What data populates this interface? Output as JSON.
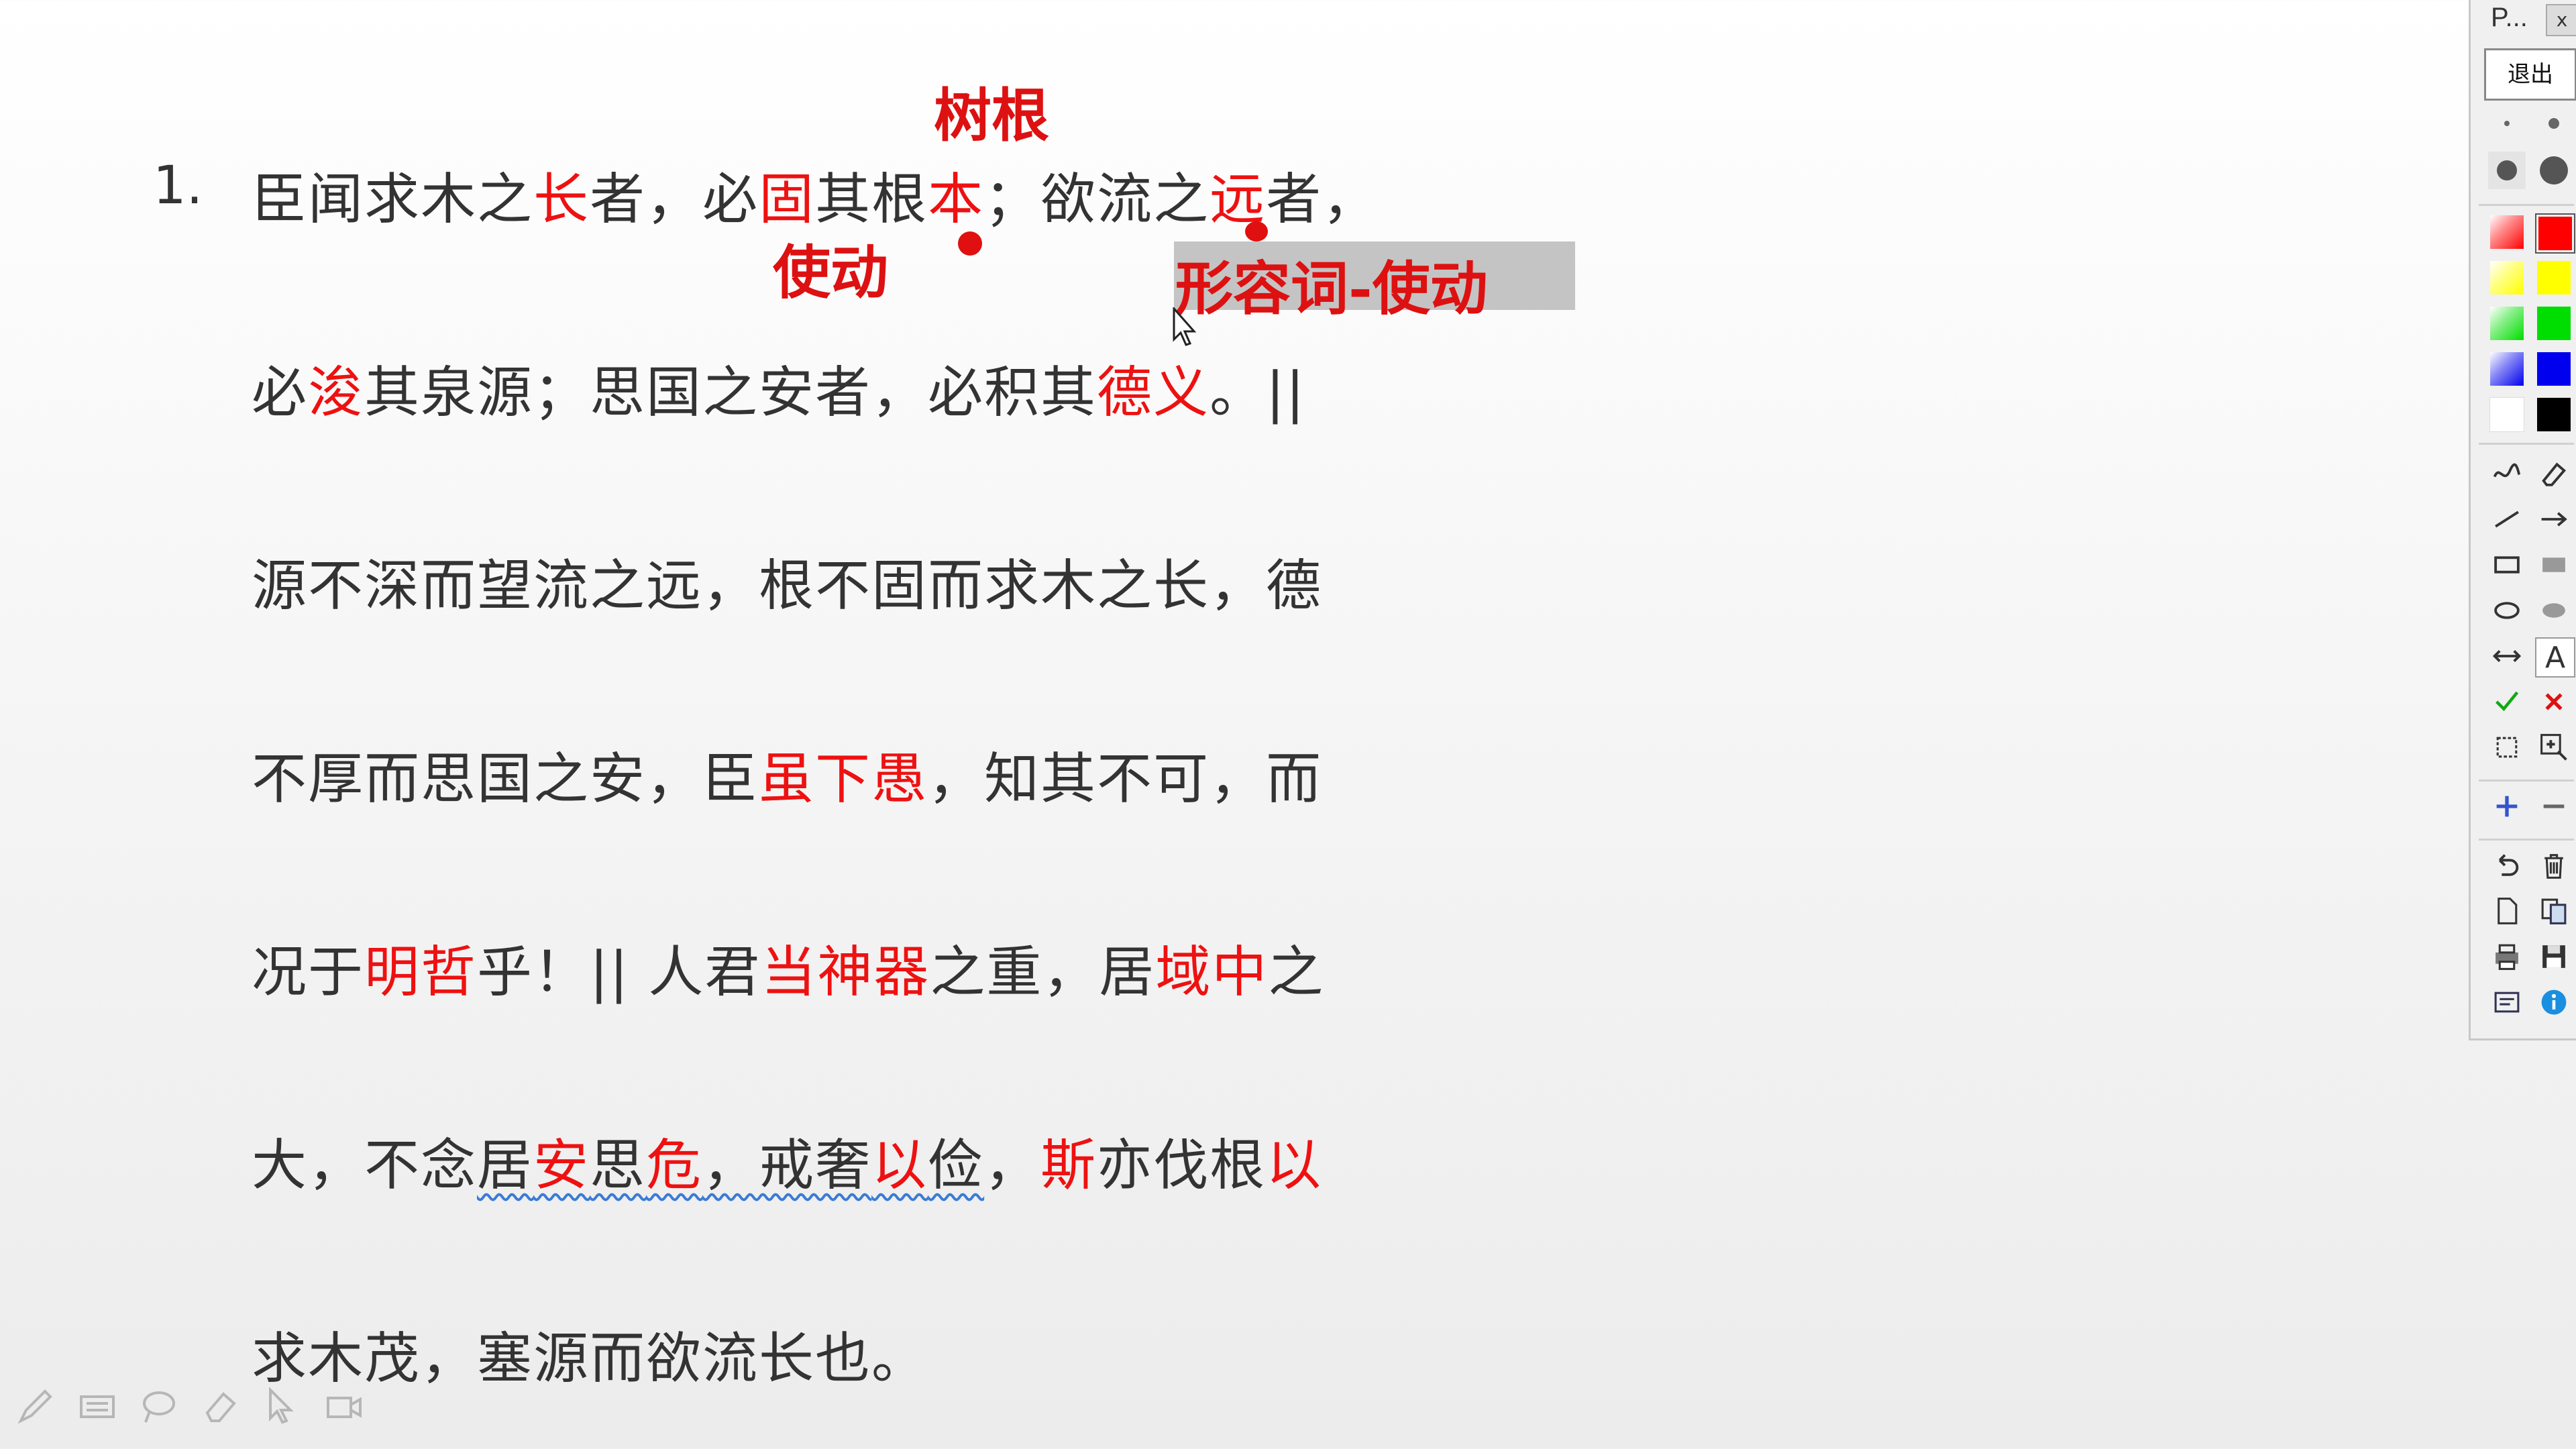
{
  "slide": {
    "number": "1.",
    "lines": [
      [
        {
          "t": "臣闻求木之"
        },
        {
          "t": "长",
          "red": true
        },
        {
          "t": "者，必"
        },
        {
          "t": "固",
          "red": true
        },
        {
          "t": "其根"
        },
        {
          "t": "本",
          "red": true
        },
        {
          "t": "；欲流之"
        },
        {
          "t": "远",
          "red": true
        },
        {
          "t": "者，"
        }
      ],
      [
        {
          "t": "必"
        },
        {
          "t": "浚",
          "red": true
        },
        {
          "t": "其泉源；思国之安者，必积其"
        },
        {
          "t": "德义",
          "red": true
        },
        {
          "t": "。||"
        }
      ],
      [
        {
          "t": "源不深而望流之远，根不固而求木之长，德"
        }
      ],
      [
        {
          "t": "不厚而思国之安，臣"
        },
        {
          "t": "虽下愚",
          "red": true
        },
        {
          "t": "，知其不可，而"
        }
      ],
      [
        {
          "t": "况于"
        },
        {
          "t": "明哲",
          "red": true
        },
        {
          "t": "乎！|| 人君"
        },
        {
          "t": "当神器",
          "red": true
        },
        {
          "t": "之重，居"
        },
        {
          "t": "域中",
          "red": true
        },
        {
          "t": "之"
        }
      ],
      [
        {
          "t": "大，不念"
        },
        {
          "t": "居",
          "sq": true
        },
        {
          "t": "安",
          "red": true,
          "sq": true
        },
        {
          "t": "思",
          "sq": true
        },
        {
          "t": "危",
          "red": true,
          "sq": true
        },
        {
          "t": "，戒奢",
          "sq": true
        },
        {
          "t": "以",
          "red": true,
          "sq": true
        },
        {
          "t": "俭",
          "sq": true
        },
        {
          "t": "，"
        },
        {
          "t": "斯",
          "red": true
        },
        {
          "t": "亦伐根"
        },
        {
          "t": "以",
          "red": true
        }
      ],
      [
        {
          "t": "求木茂，塞源而欲流长也。"
        }
      ]
    ],
    "annotations": {
      "shugen": "树根",
      "shidong": "使动",
      "xingrongci": "形容词-使动"
    }
  },
  "palette": {
    "title": "P...",
    "close": "x",
    "exit": "退出",
    "text_tool": "A",
    "colors": [
      "#ff0000",
      "#ffff00",
      "#00dd00",
      "#0000ee",
      "#ffffff",
      "#000000"
    ]
  }
}
